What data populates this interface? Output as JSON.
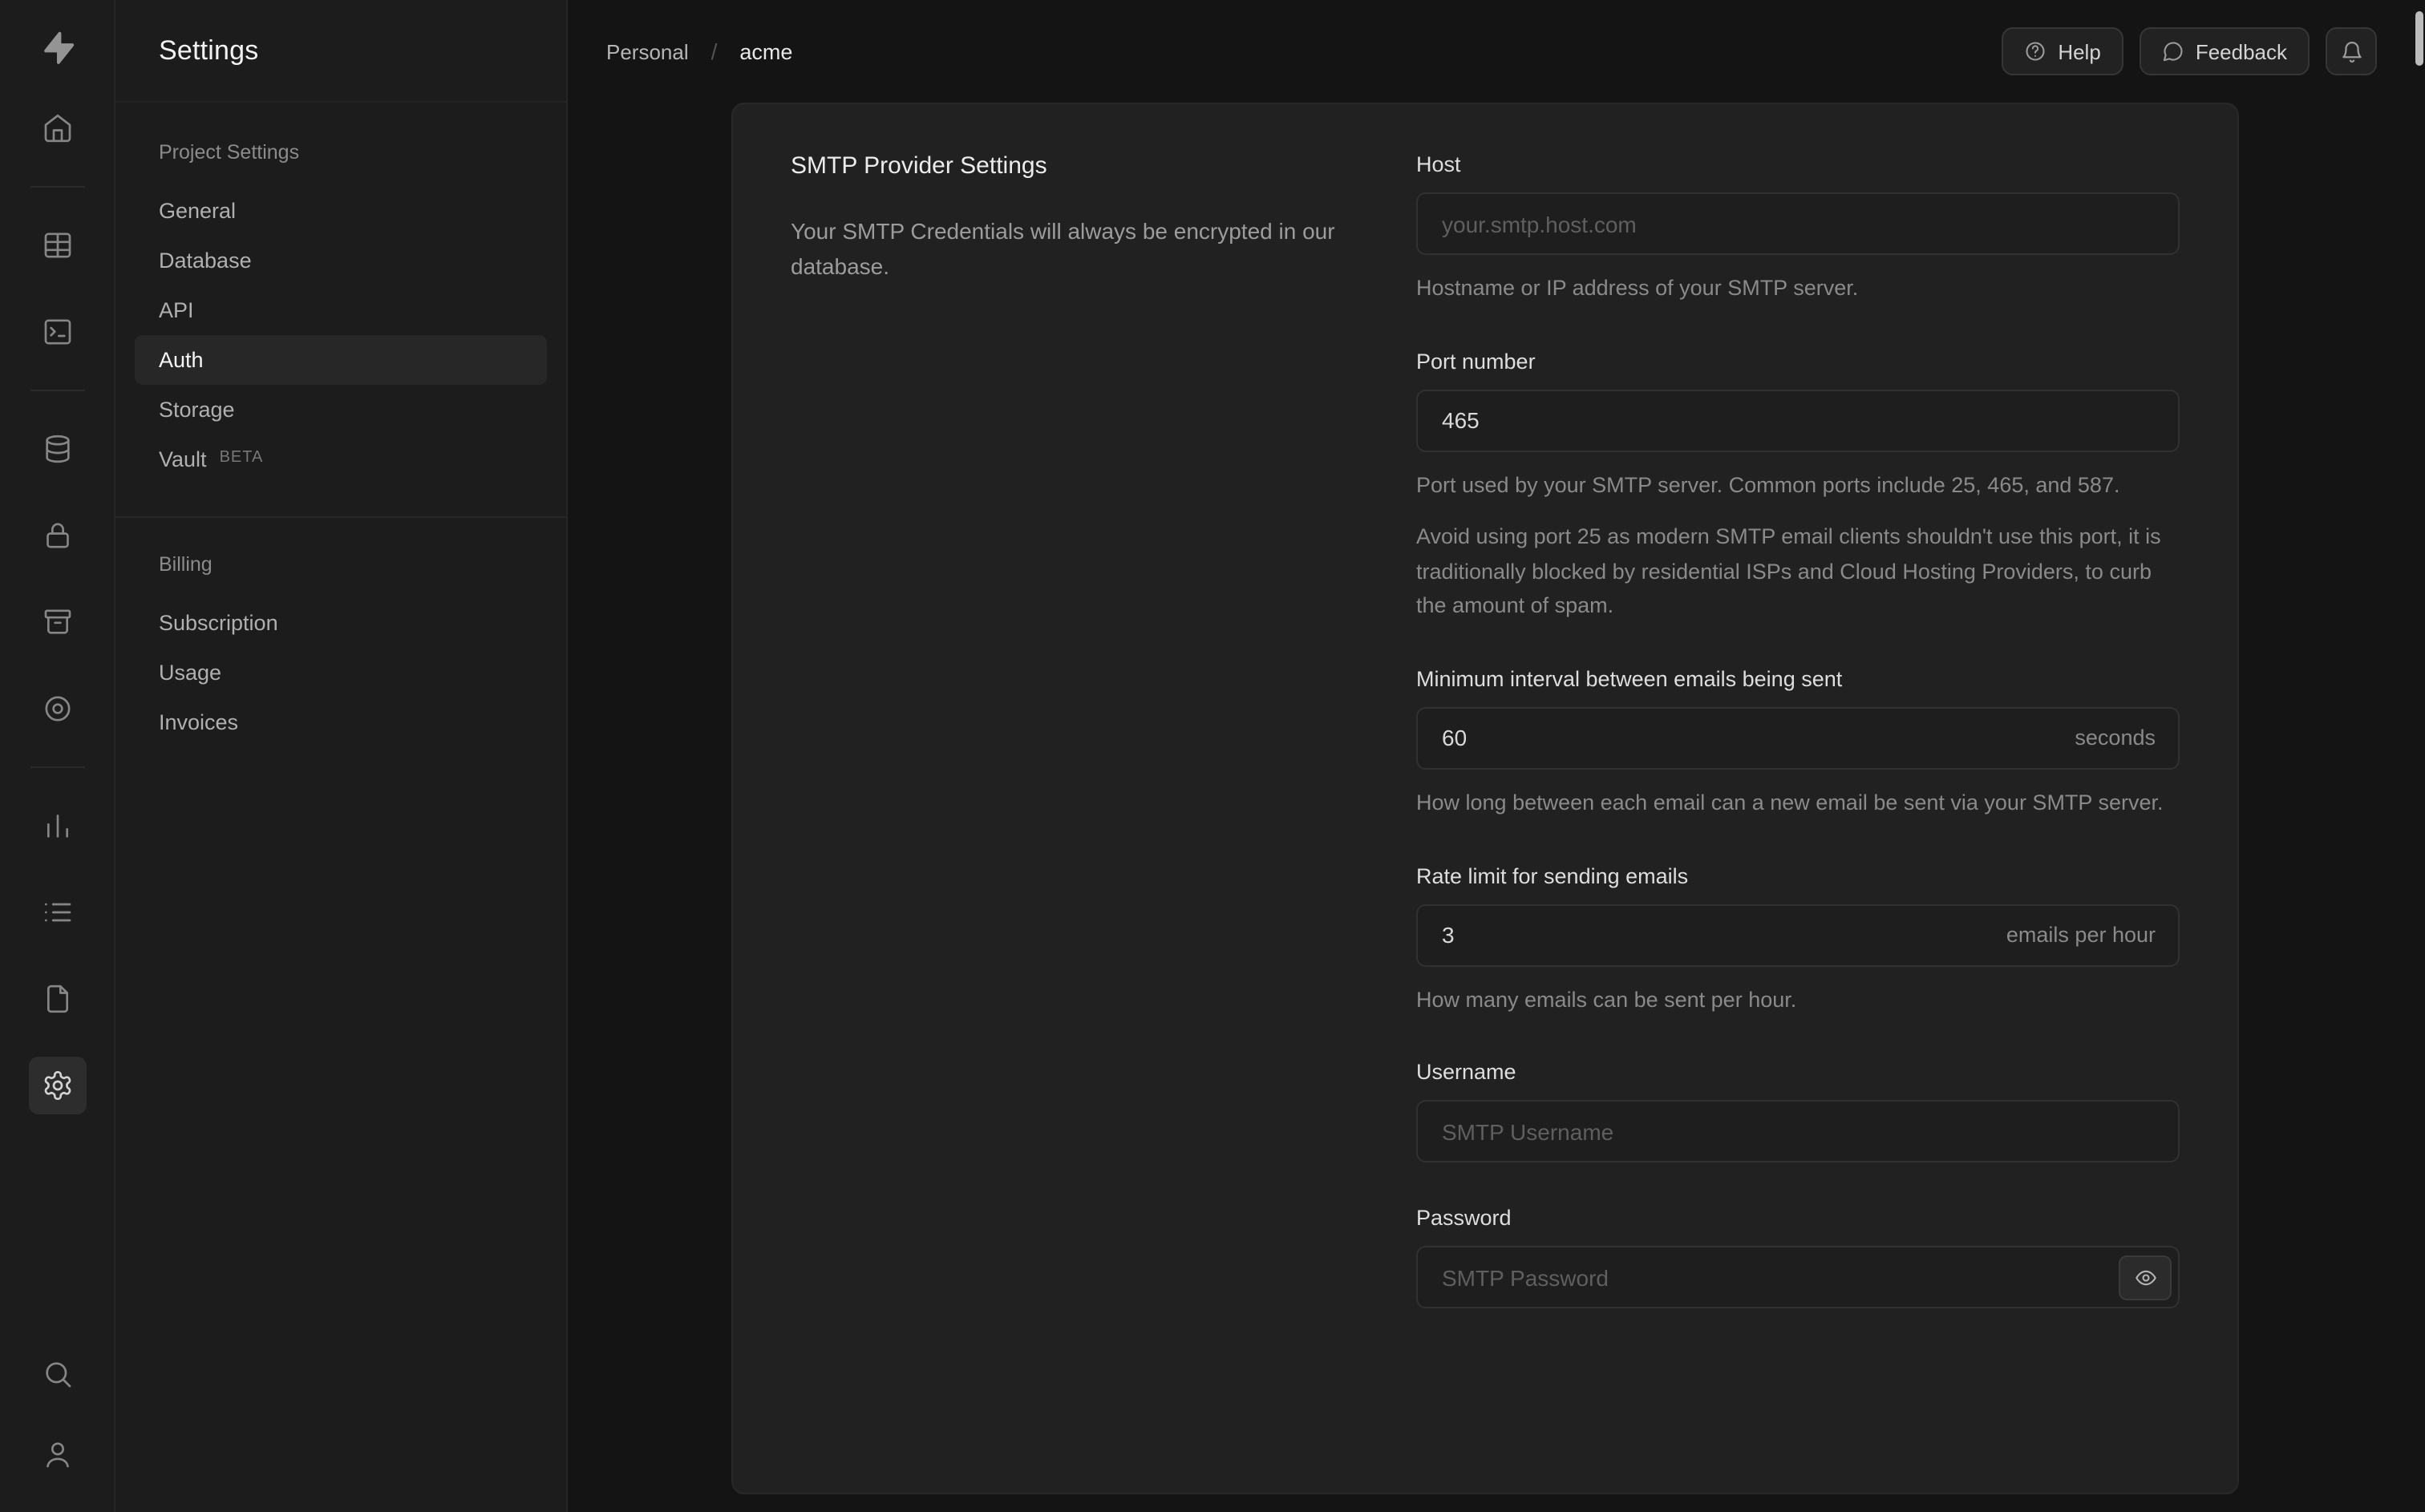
{
  "colors": {
    "page_bg": "#141414",
    "surface": "#1c1c1c",
    "panel": "#212121",
    "border": "#2e2e2e",
    "text": "#ececec",
    "muted_text": "#8a8a8a"
  },
  "rail": {
    "icons": [
      "supabase-logo",
      "home",
      "table-editor",
      "sql-editor",
      "database",
      "auth",
      "storage",
      "edge-functions",
      "reports",
      "logs",
      "docs",
      "settings",
      "search",
      "user"
    ],
    "active": "settings"
  },
  "sidebar": {
    "title": "Settings",
    "sections": [
      {
        "label": "Project Settings",
        "items": [
          {
            "label": "General"
          },
          {
            "label": "Database"
          },
          {
            "label": "API"
          },
          {
            "label": "Auth",
            "active": true
          },
          {
            "label": "Storage"
          },
          {
            "label": "Vault",
            "badge": "BETA"
          }
        ]
      },
      {
        "label": "Billing",
        "items": [
          {
            "label": "Subscription"
          },
          {
            "label": "Usage"
          },
          {
            "label": "Invoices"
          }
        ]
      }
    ]
  },
  "header": {
    "breadcrumb": [
      {
        "label": "Personal"
      },
      {
        "label": "acme"
      }
    ],
    "separator": "/",
    "actions": {
      "help": "Help",
      "feedback": "Feedback"
    },
    "action_icons": [
      "help-circle",
      "speech-bubble",
      "bell"
    ]
  },
  "panel": {
    "title": "SMTP Provider Settings",
    "description": "Your SMTP Credentials will always be encrypted in our database.",
    "fields": {
      "host": {
        "label": "Host",
        "placeholder": "your.smtp.host.com",
        "help": "Hostname or IP address of your SMTP server."
      },
      "port": {
        "label": "Port number",
        "value": "465",
        "help1": "Port used by your SMTP server. Common ports include 25, 465, and 587.",
        "help2": "Avoid using port 25 as modern SMTP email clients shouldn't use this port, it is traditionally blocked by residential ISPs and Cloud Hosting Providers, to curb the amount of spam."
      },
      "interval": {
        "label": "Minimum interval between emails being sent",
        "value": "60",
        "suffix": "seconds",
        "help": "How long between each email can a new email be sent via your SMTP server."
      },
      "rate": {
        "label": "Rate limit for sending emails",
        "value": "3",
        "suffix": "emails per hour",
        "help": "How many emails can be sent per hour."
      },
      "username": {
        "label": "Username",
        "placeholder": "SMTP Username"
      },
      "password": {
        "label": "Password",
        "placeholder": "SMTP Password"
      }
    }
  }
}
